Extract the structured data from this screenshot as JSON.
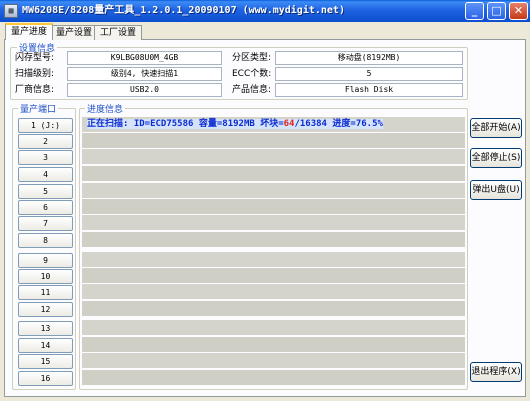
{
  "window": {
    "title": "MW6208E/8208量产工具_1.2.0.1_20090107 (www.mydigit.net)",
    "icon_text": "▦",
    "controls": {
      "minimize": "_",
      "maximize": "□",
      "close": "✕"
    }
  },
  "tabs": [
    {
      "label": "量产进度",
      "active": true
    },
    {
      "label": "量产设置",
      "active": false
    },
    {
      "label": "工厂设置",
      "active": false
    }
  ],
  "settings_info": {
    "title": "设置信息",
    "flash_model_label": "闪存型号:",
    "flash_model_value": "K9LBG08U0M_4GB",
    "partition_type_label": "分区类型:",
    "partition_type_value": "移动盘(8192MB)",
    "scan_level_label": "扫描级别:",
    "scan_level_value": "级别4, 快速扫描1",
    "ecc_label": "ECC个数:",
    "ecc_value": "5",
    "vendor_label": "厂商信息:",
    "vendor_value": "USB2.0",
    "product_label": "产品信息:",
    "product_value": "Flash Disk"
  },
  "ports": {
    "title": "量产端口",
    "labels": [
      "1 (J:)",
      "2",
      "3",
      "4",
      "5",
      "6",
      "7",
      "8",
      "9",
      "10",
      "11",
      "12",
      "13",
      "14",
      "15",
      "16"
    ]
  },
  "progress": {
    "title": "进度信息",
    "line_prefix": "正在扫描: ID=ECD75586 容量=8192MB 坏块=",
    "bad_blocks": "64",
    "line_suffix": "/16384 进度=76.5%",
    "percent": 76.5
  },
  "buttons": {
    "start_all": "全部开始(A)",
    "stop_all": "全部停止(S)",
    "eject_drive": "弹出U盘(U)",
    "exit": "退出程序(X)"
  },
  "colors": {
    "title_bar": "#0b4fd0",
    "group_title": "#1c4fc6",
    "bad_block": "#e0241c",
    "progress_text": "#0a2bd0"
  }
}
